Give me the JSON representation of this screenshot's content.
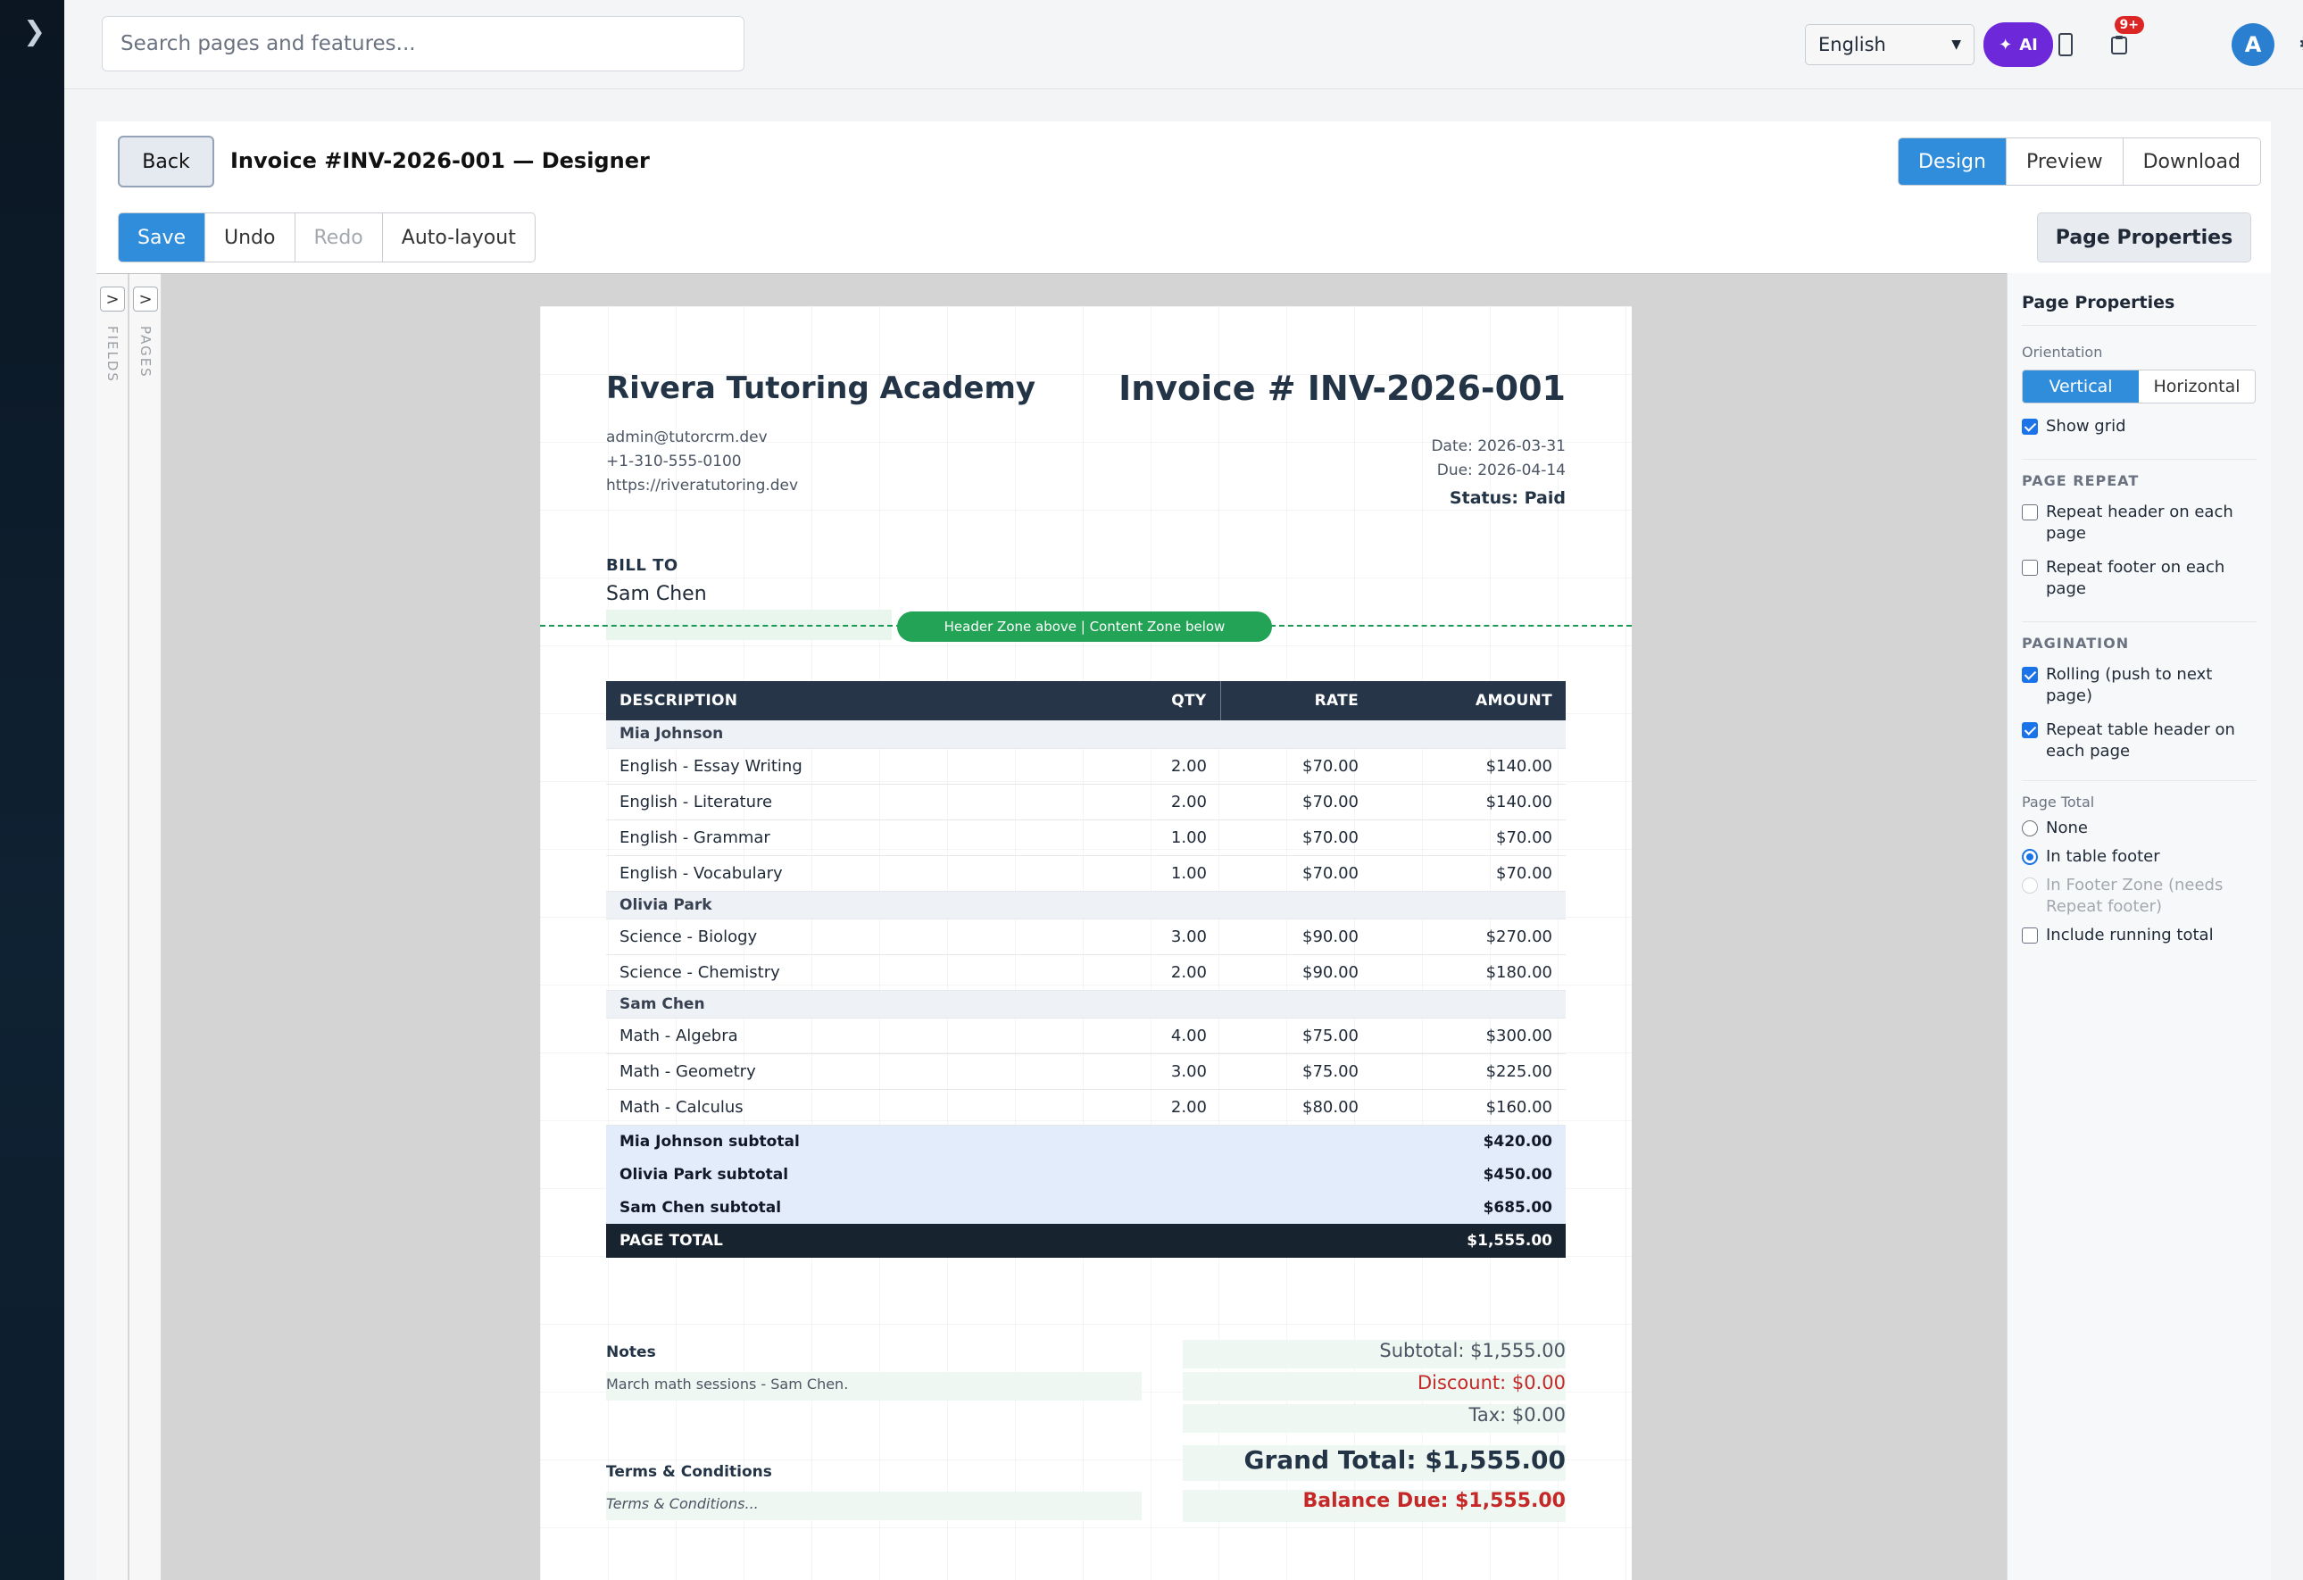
{
  "topbar": {
    "search_placeholder": "Search pages and features...",
    "language": "English",
    "ai_label": "AI",
    "notif_count": "9+",
    "avatar_initial": "A"
  },
  "header": {
    "back_label": "Back",
    "title": "Invoice #INV-2026-001 — Designer",
    "views": [
      "Design",
      "Preview",
      "Download"
    ],
    "active_view": "Design"
  },
  "toolbar": {
    "save": "Save",
    "undo": "Undo",
    "redo": "Redo",
    "autolayout": "Auto-layout",
    "page_props": "Page Properties"
  },
  "side_tabs": {
    "fields": "FIELDS",
    "pages": "PAGES",
    "expand_glyph": ">"
  },
  "invoice": {
    "company": "Rivera Tutoring Academy",
    "title": "Invoice # INV-2026-001",
    "email": "admin@tutorcrm.dev",
    "phone": "+1-310-555-0100",
    "website": "https://riveratutoring.dev",
    "date": "Date: 2026-03-31",
    "due": "Due: 2026-04-14",
    "status": "Status: Paid",
    "bill_to_label": "BILL TO",
    "bill_to_name": "Sam Chen",
    "zone_label": "Header Zone above | Content Zone below",
    "columns": [
      "DESCRIPTION",
      "QTY",
      "RATE",
      "AMOUNT"
    ],
    "groups": [
      {
        "name": "Mia Johnson",
        "items": [
          {
            "desc": "English - Essay Writing",
            "qty": "2.00",
            "rate": "$70.00",
            "amount": "$140.00"
          },
          {
            "desc": "English - Literature",
            "qty": "2.00",
            "rate": "$70.00",
            "amount": "$140.00"
          },
          {
            "desc": "English - Grammar",
            "qty": "1.00",
            "rate": "$70.00",
            "amount": "$70.00"
          },
          {
            "desc": "English - Vocabulary",
            "qty": "1.00",
            "rate": "$70.00",
            "amount": "$70.00"
          }
        ]
      },
      {
        "name": "Olivia Park",
        "items": [
          {
            "desc": "Science - Biology",
            "qty": "3.00",
            "rate": "$90.00",
            "amount": "$270.00"
          },
          {
            "desc": "Science - Chemistry",
            "qty": "2.00",
            "rate": "$90.00",
            "amount": "$180.00"
          }
        ]
      },
      {
        "name": "Sam Chen",
        "items": [
          {
            "desc": "Math - Algebra",
            "qty": "4.00",
            "rate": "$75.00",
            "amount": "$300.00"
          },
          {
            "desc": "Math - Geometry",
            "qty": "3.00",
            "rate": "$75.00",
            "amount": "$225.00"
          },
          {
            "desc": "Math - Calculus",
            "qty": "2.00",
            "rate": "$80.00",
            "amount": "$160.00"
          }
        ]
      }
    ],
    "subtotals": [
      {
        "label": "Mia Johnson subtotal",
        "amount": "$420.00"
      },
      {
        "label": "Olivia Park subtotal",
        "amount": "$450.00"
      },
      {
        "label": "Sam Chen subtotal",
        "amount": "$685.00"
      }
    ],
    "page_total_label": "PAGE TOTAL",
    "page_total": "$1,555.00",
    "notes_label": "Notes",
    "notes": "March math sessions - Sam Chen.",
    "terms_label": "Terms & Conditions",
    "terms": "Terms & Conditions...",
    "subtotal": "Subtotal: $1,555.00",
    "discount": "Discount: $0.00",
    "tax": "Tax: $0.00",
    "grand_total": "Grand Total: $1,555.00",
    "balance_due": "Balance Due: $1,555.00"
  },
  "properties": {
    "title": "Page Properties",
    "orientation_label": "Orientation",
    "orientation_options": [
      "Vertical",
      "Horizontal"
    ],
    "show_grid": "Show grid",
    "page_repeat_label": "PAGE REPEAT",
    "repeat_header": "Repeat header on each page",
    "repeat_footer": "Repeat footer on each page",
    "pagination_label": "PAGINATION",
    "rolling": "Rolling (push to next page)",
    "repeat_table_header": "Repeat table header on each page",
    "page_total_label": "Page Total",
    "none": "None",
    "in_table_footer": "In table footer",
    "in_footer_zone": "In Footer Zone (needs Repeat footer)",
    "running_total": "Include running total"
  },
  "colors": {
    "accent": "#2f8ddb",
    "ai_purple": "#6d28d9",
    "zone_green": "#22a355",
    "table_header": "#263548",
    "danger": "#c62828"
  }
}
